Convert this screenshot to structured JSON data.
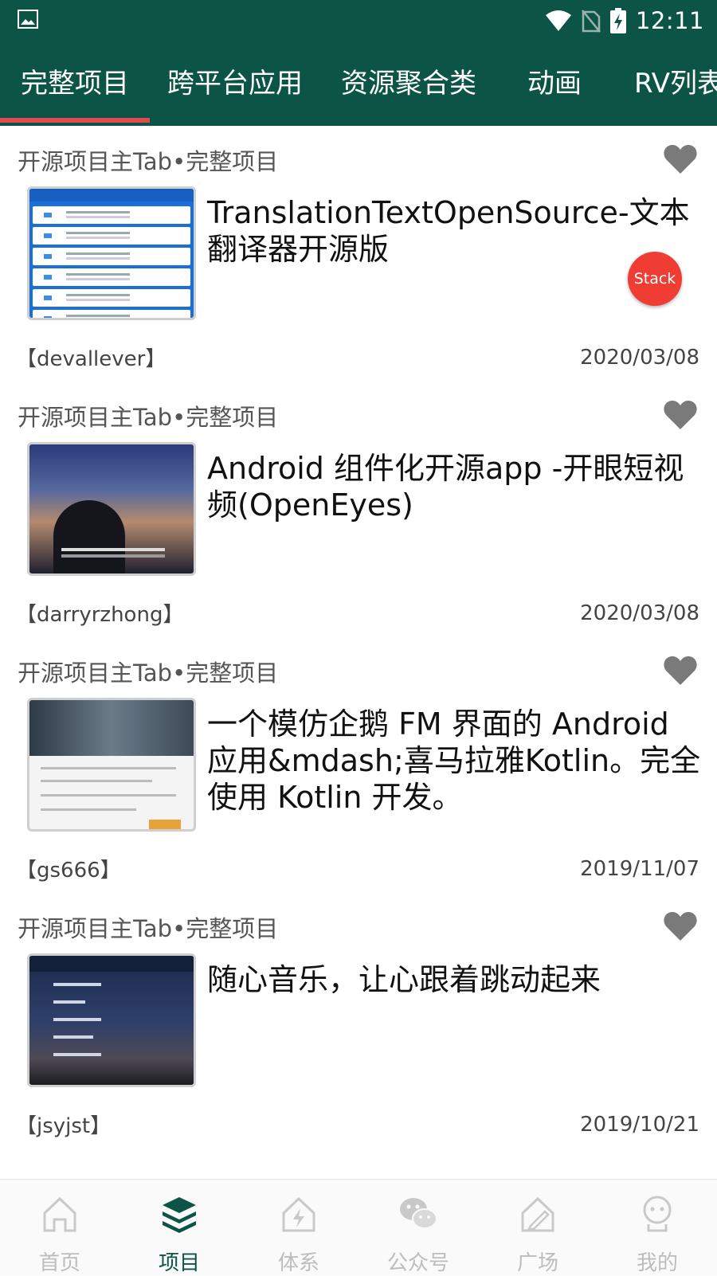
{
  "status_bar": {
    "time": "12:11"
  },
  "tabs": [
    {
      "label": "完整项目",
      "active": true
    },
    {
      "label": "跨平台应用"
    },
    {
      "label": "资源聚合类"
    },
    {
      "label": "动画"
    },
    {
      "label": "RV列表"
    }
  ],
  "accent_colors": {
    "primary": "#0c5446",
    "indicator": "#e04a4a",
    "badge": "#ef3d34"
  },
  "feed": [
    {
      "category": "开源项目主Tab•完整项目",
      "title": "TranslationTextOpenSource-文本翻译器开源版",
      "author": "【devallever】",
      "date": "2020/03/08",
      "badge": "Stack"
    },
    {
      "category": "开源项目主Tab•完整项目",
      "title": "Android 组件化开源app -开眼短视频(OpenEyes)",
      "author": "【darryrzhong】",
      "date": "2020/03/08"
    },
    {
      "category": "开源项目主Tab•完整项目",
      "title": "一个模仿企鹅 FM 界面的 Android 应用&mdash;喜马拉雅Kotlin。完全使用 Kotlin 开发。",
      "author": "【gs666】",
      "date": "2019/11/07"
    },
    {
      "category": "开源项目主Tab•完整项目",
      "title": "随心音乐，让心跟着跳动起来",
      "author": "【jsyjst】",
      "date": "2019/10/21"
    }
  ],
  "bottom_nav": [
    {
      "label": "首页",
      "icon": "home-icon"
    },
    {
      "label": "项目",
      "icon": "layers-icon",
      "active": true
    },
    {
      "label": "体系",
      "icon": "lightning-house-icon"
    },
    {
      "label": "公众号",
      "icon": "wechat-icon"
    },
    {
      "label": "广场",
      "icon": "plaza-icon"
    },
    {
      "label": "我的",
      "icon": "person-icon"
    }
  ]
}
